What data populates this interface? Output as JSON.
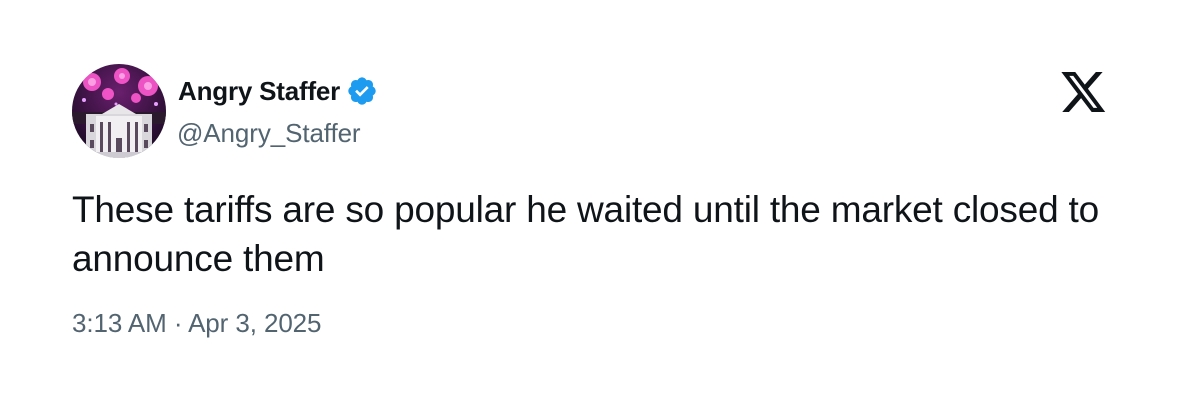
{
  "author": {
    "name": "Angry Staffer",
    "handle": "@Angry_Staffer",
    "verified": true,
    "verified_color": "#1d9bf0",
    "avatar_icon": "white-house-fireworks-avatar"
  },
  "platform_icon": "x-logo-icon",
  "tweet": {
    "text": "These tariffs are so popular he waited until the market closed to announce them",
    "timestamp": "3:13 AM · Apr 3, 2025"
  },
  "colors": {
    "text_primary": "#0f1419",
    "text_secondary": "#536471",
    "accent": "#1d9bf0"
  }
}
